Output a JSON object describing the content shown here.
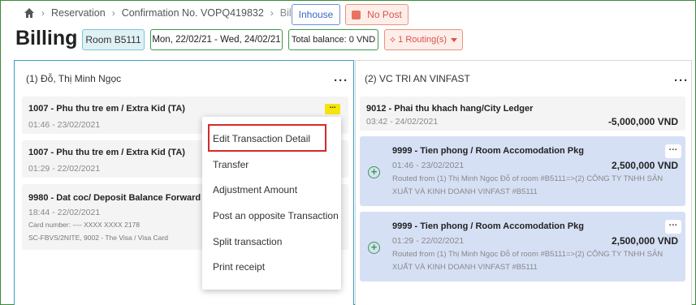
{
  "breadcrumb": {
    "items": [
      "Reservation",
      "Confirmation No. VOPQ419832",
      "Billing"
    ]
  },
  "header": {
    "inhouse": "Inhouse",
    "nopost": "No Post",
    "title": "Billing",
    "room": "Room B5111",
    "dates": "Mon, 22/02/21 - Wed, 24/02/21",
    "balance": "Total balance: 0 VND",
    "routing": "1 Routing(s)"
  },
  "left_panel": {
    "title": "(1) Đỗ, Thị Minh Ngọc",
    "cards": [
      {
        "title": "1007 - Phu thu tre em / Extra Kid (TA)",
        "date": "01:46 - 23/02/2021"
      },
      {
        "title": "1007 - Phu thu tre em / Extra Kid (TA)",
        "date": "01:29 - 22/02/2021"
      },
      {
        "title": "9980 - Dat coc/ Deposit Balance Forward",
        "date": "18:44 - 22/02/2021",
        "card_number": "Card number: ---- XXXX XXXX 2178",
        "extra": "SC-FBVS/2NITE, 9002 - The Visa /  Visa Card"
      }
    ]
  },
  "right_panel": {
    "title": "(2) VC TRI AN VINFAST",
    "cards": [
      {
        "title": "9012 - Phai thu khach hang/City Ledger",
        "date": "03:42 - 24/02/2021",
        "amount": "-5,000,000 VND"
      },
      {
        "title": "9999 - Tien phong / Room Accomodation Pkg",
        "date": "01:46 - 23/02/2021",
        "amount": "2,500,000 VND",
        "route1": "Routed from (1) Thị Minh Ngọc Đỗ of room #B5111=>(2) CÔNG TY TNHH SẢN",
        "route2": "XUẤT VÀ KINH DOANH VINFAST #B5111"
      },
      {
        "title": "9999 - Tien phong / Room Accomodation Pkg",
        "date": "01:29 - 22/02/2021",
        "amount": "2,500,000 VND",
        "route1": "Routed from (1) Thị Minh Ngọc Đỗ of room #B5111=>(2) CÔNG TY TNHH SẢN",
        "route2": "XUẤT VÀ KINH DOANH VINFAST #B5111"
      }
    ]
  },
  "menu": {
    "items": [
      "Edit Transaction Detail",
      "Transfer",
      "Adjustment Amount",
      "Post an opposite Transaction",
      "Split transaction",
      "Print receipt"
    ]
  },
  "colors": {
    "accent": "#3b66c4",
    "danger": "#d9534f",
    "success": "#3a9a4e",
    "highlight": "#f5e50a"
  }
}
